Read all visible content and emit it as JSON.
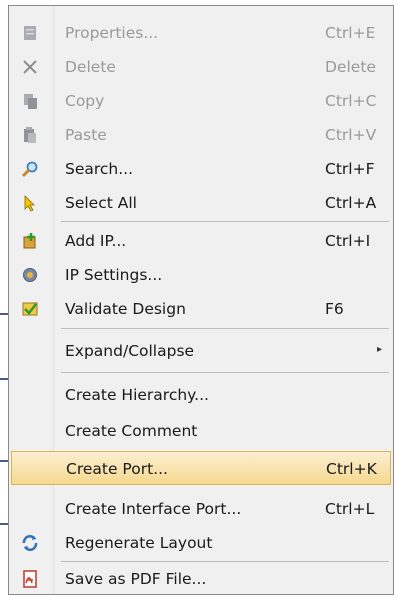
{
  "menu": {
    "items": [
      {
        "label": "Properties...",
        "shortcut": "Ctrl+E",
        "icon": "properties-icon",
        "disabled": true
      },
      {
        "label": "Delete",
        "shortcut": "Delete",
        "icon": "delete-icon",
        "disabled": true
      },
      {
        "label": "Copy",
        "shortcut": "Ctrl+C",
        "icon": "copy-icon",
        "disabled": true
      },
      {
        "label": "Paste",
        "shortcut": "Ctrl+V",
        "icon": "paste-icon",
        "disabled": true
      },
      {
        "label": "Search...",
        "shortcut": "Ctrl+F",
        "icon": "search-icon",
        "disabled": false
      },
      {
        "label": "Select All",
        "shortcut": "Ctrl+A",
        "icon": "select-all-icon",
        "disabled": false
      },
      {
        "label": "Add IP...",
        "shortcut": "Ctrl+I",
        "icon": "add-ip-icon",
        "disabled": false
      },
      {
        "label": "IP Settings...",
        "shortcut": "",
        "icon": "ip-settings-icon",
        "disabled": false
      },
      {
        "label": "Validate Design",
        "shortcut": "F6",
        "icon": "validate-design-icon",
        "disabled": false
      },
      {
        "label": "Expand/Collapse",
        "shortcut": "",
        "icon": "",
        "disabled": false,
        "submenu": true
      },
      {
        "label": "Create Hierarchy...",
        "shortcut": "",
        "icon": "",
        "disabled": false
      },
      {
        "label": "Create Comment",
        "shortcut": "",
        "icon": "",
        "disabled": false
      },
      {
        "label": "Create Port...",
        "shortcut": "Ctrl+K",
        "icon": "",
        "disabled": false,
        "highlighted": true
      },
      {
        "label": "Create Interface Port...",
        "shortcut": "Ctrl+L",
        "icon": "",
        "disabled": false
      },
      {
        "label": "Regenerate Layout",
        "shortcut": "",
        "icon": "regenerate-layout-icon",
        "disabled": false
      },
      {
        "label": "Save as PDF File...",
        "shortcut": "",
        "icon": "pdf-file-icon",
        "disabled": false
      }
    ],
    "submenu_arrow": "▸",
    "highlight_color": "#f6d88f",
    "disabled_color": "#9a9a9a"
  }
}
